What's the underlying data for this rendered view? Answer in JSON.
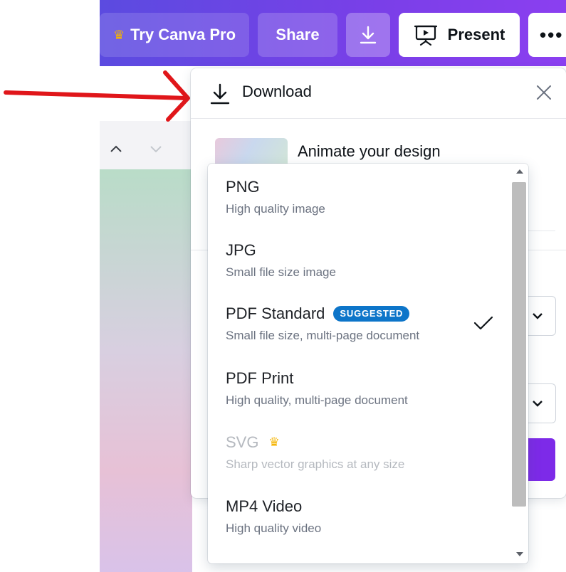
{
  "toolbar": {
    "pro_label": "Try Canva Pro",
    "share_label": "Share",
    "present_label": "Present",
    "more_label": "•••"
  },
  "icons": {
    "crown": "crown-icon",
    "download": "download-icon",
    "present": "presentation-icon",
    "close": "close-icon",
    "check": "check-icon"
  },
  "panel": {
    "title": "Download",
    "animate_title": "Animate your design"
  },
  "formats": [
    {
      "label": "PNG",
      "desc": "High quality image",
      "selected": false,
      "disabled": false
    },
    {
      "label": "JPG",
      "desc": "Small file size image",
      "selected": false,
      "disabled": false
    },
    {
      "label": "PDF Standard",
      "desc": "Small file size, multi-page document",
      "badge": "SUGGESTED",
      "selected": true,
      "disabled": false
    },
    {
      "label": "PDF Print",
      "desc": "High quality, multi-page document",
      "selected": false,
      "disabled": false
    },
    {
      "label": "SVG",
      "desc": "Sharp vector graphics at any size",
      "pro": true,
      "selected": false,
      "disabled": true
    },
    {
      "label": "MP4 Video",
      "desc": "High quality video",
      "selected": false,
      "disabled": false
    }
  ],
  "colors": {
    "brand_purple": "#7d2ae8",
    "badge_blue": "#0d75c9",
    "crown_gold": "#f5b400",
    "annotation_red": "#e0161a"
  }
}
